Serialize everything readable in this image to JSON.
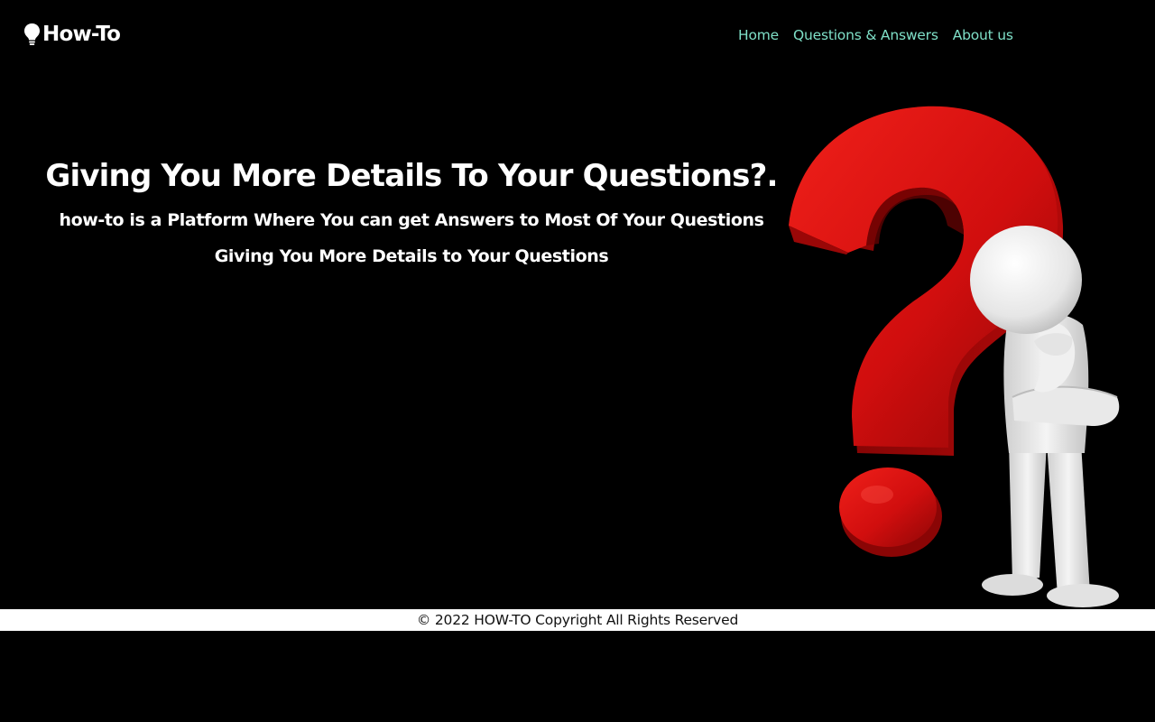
{
  "brand": {
    "name": "How-To",
    "icon": "lightbulb-icon"
  },
  "nav": {
    "items": [
      {
        "label": "Home"
      },
      {
        "label": "Questions & Answers"
      },
      {
        "label": "About us"
      }
    ]
  },
  "hero": {
    "title": "Giving You More Details To Your Questions?.",
    "subtitle": "how-to is a Platform Where You can get Answers to Most Of Your Questions Giving You More Details to Your Questions"
  },
  "illustration": {
    "icon": "question-mark-figure-illustration"
  },
  "footer": {
    "text": "© 2022 HOW-TO Copyright All Rights Reserved"
  },
  "colors": {
    "background": "#000000",
    "nav_link": "#7fe0c8",
    "accent_red": "#d40f0f",
    "footer_bg": "#ffffff"
  }
}
